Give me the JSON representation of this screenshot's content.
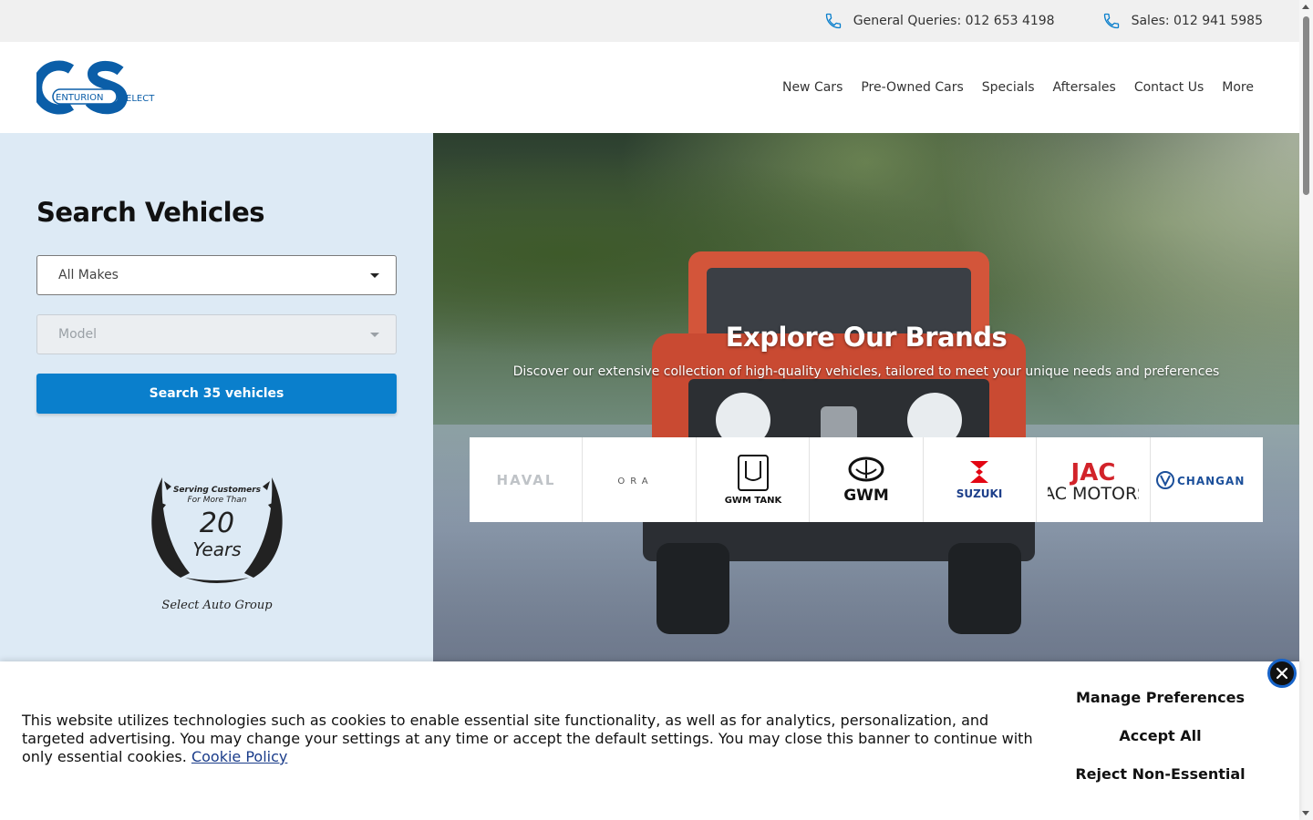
{
  "topbar": {
    "general": "General Queries: 012 653 4198",
    "sales": "Sales: 012 941 5985"
  },
  "logo": {
    "letters": "CS",
    "word1": "ENTURION",
    "word2": "ELECT"
  },
  "nav": {
    "items": [
      "New Cars",
      "Pre-Owned Cars",
      "Specials",
      "Aftersales",
      "Contact Us",
      "More"
    ]
  },
  "search": {
    "title": "Search Vehicles",
    "make_value": "All Makes",
    "model_value": "Model",
    "button": "Search 35 vehicles"
  },
  "award": {
    "line1": "Serving Customers",
    "line2": "For More Than",
    "number": "20",
    "unit": "Years",
    "brand": "Select Auto Group"
  },
  "hero": {
    "title": "Explore Our Brands",
    "subtitle": "Discover our extensive collection of high-quality vehicles, tailored to meet your unique needs and preferences",
    "brands": [
      "HAVAL",
      "ORA",
      "GWM TANK",
      "GWM",
      "SUZUKI",
      "JAC MOTORS",
      "CHANGAN"
    ]
  },
  "cookie": {
    "text": "This website utilizes technologies such as cookies to enable essential site functionality, as well as for analytics, personalization, and targeted advertising. You may change your settings at any time or accept the default settings. You may close this banner to continue with only essential cookies.",
    "link": "Cookie Policy",
    "manage": "Manage Preferences",
    "accept": "Accept All",
    "reject": "Reject Non-Essential"
  },
  "colors": {
    "brand_blue": "#0a7fcc",
    "logo_blue": "#0b5ea8",
    "panel_bg": "#ddeaf5",
    "jac_red": "#d2232a",
    "suzuki_red": "#e30613"
  }
}
